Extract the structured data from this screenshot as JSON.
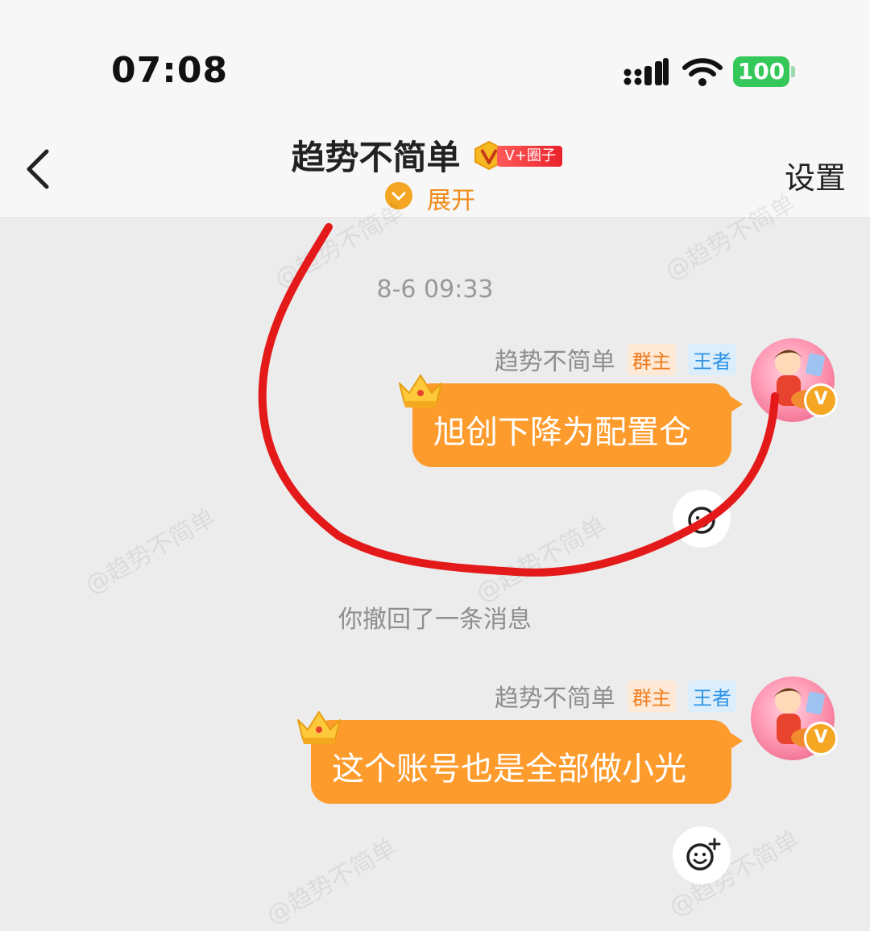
{
  "status_bar": {
    "time": "07:08",
    "battery": "100"
  },
  "nav": {
    "title": "趋势不简单",
    "badge_label": "V+圈子",
    "expand_label": "展开",
    "settings_label": "设置"
  },
  "watermark_text": "@趋势不简单",
  "messages": {
    "timestamp": "8-6 09:33",
    "items": [
      {
        "sender": "趋势不简单",
        "tag_owner": "群主",
        "tag_king": "王者",
        "text": "旭创下降为配置仓"
      },
      {
        "sender": "趋势不简单",
        "tag_owner": "群主",
        "tag_king": "王者",
        "text": "这个账号也是全部做小光"
      }
    ],
    "recall_notice": "你撤回了一条消息"
  },
  "colors": {
    "bubble": "#fe9b2d",
    "accent": "#f5a623",
    "annotation": "#e41a1a"
  }
}
